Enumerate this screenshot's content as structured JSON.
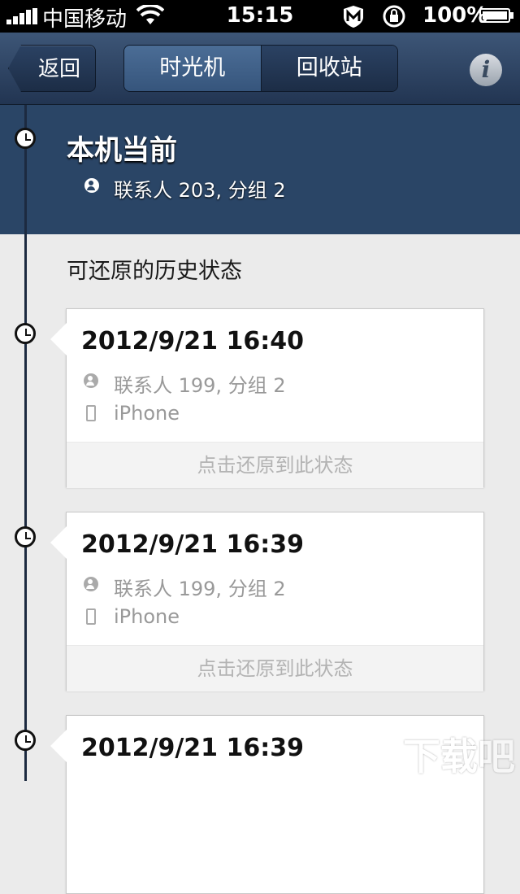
{
  "status_bar": {
    "carrier": "中国移动",
    "time": "15:15",
    "battery": "100%"
  },
  "nav": {
    "back_label": "返回",
    "segments": [
      "时光机",
      "回收站"
    ],
    "active_segment": "时光机",
    "info_label": "i"
  },
  "current": {
    "title": "本机当前",
    "contacts": "联系人 203, 分组 2"
  },
  "history": {
    "section_title": "可还原的历史状态",
    "entries": [
      {
        "time": "2012/9/21 16:40",
        "contacts": "联系人 199, 分组 2",
        "device": "iPhone",
        "restore_label": "点击还原到此状态"
      },
      {
        "time": "2012/9/21 16:39",
        "contacts": "联系人 199, 分组 2",
        "device": "iPhone",
        "restore_label": "点击还原到此状态"
      },
      {
        "time": "2012/9/21 16:39"
      }
    ]
  },
  "watermark": "下载吧",
  "colors": {
    "nav_bg": "#2b4263",
    "current_bg": "#2a4566",
    "page_bg": "#ebebeb"
  }
}
